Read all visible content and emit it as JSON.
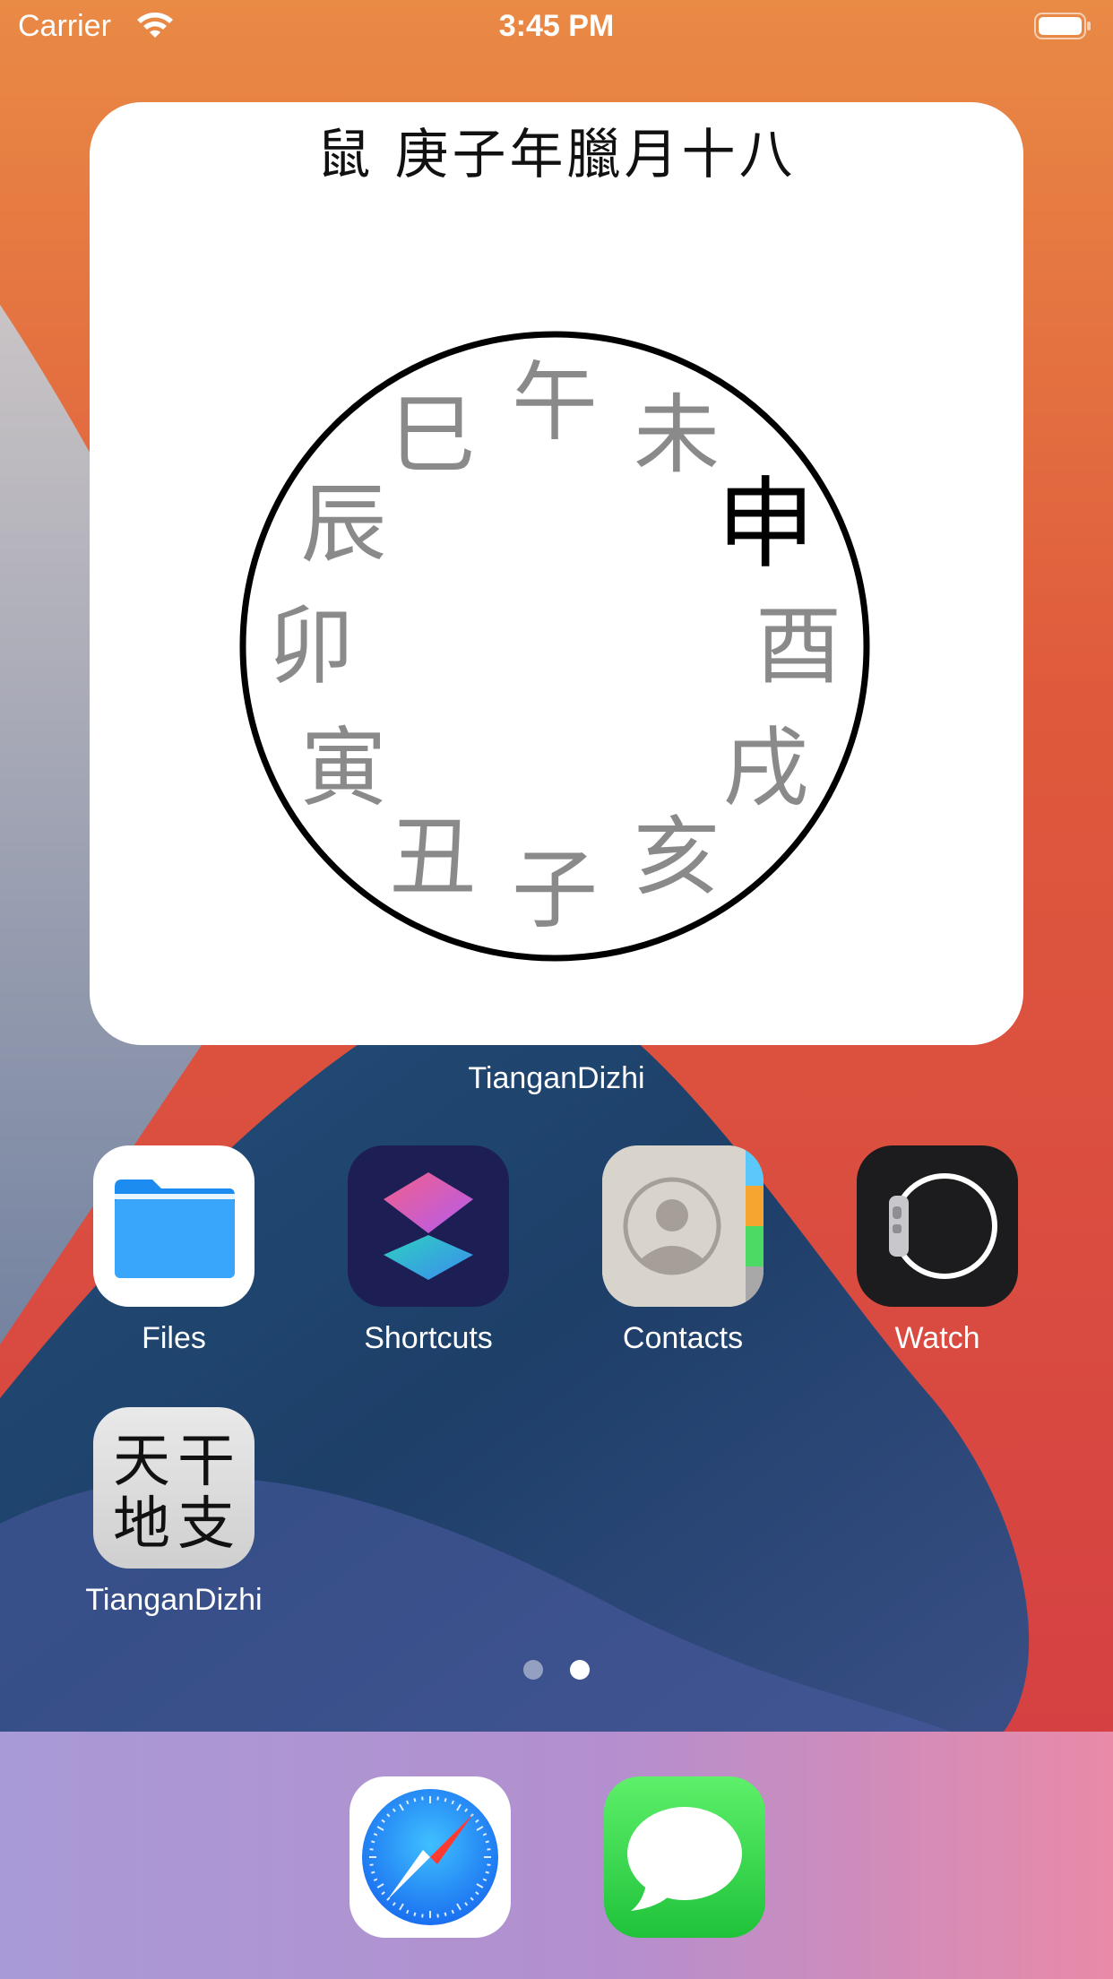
{
  "status_bar": {
    "carrier": "Carrier",
    "time": "3:45 PM"
  },
  "widget": {
    "title": "鼠 庚子年臘月十八",
    "branches": [
      "午",
      "未",
      "申",
      "酉",
      "戌",
      "亥",
      "子",
      "丑",
      "寅",
      "卯",
      "辰",
      "巳"
    ],
    "active_branch": "申",
    "label": "TianganDizhi"
  },
  "apps": [
    {
      "label": "Files",
      "icon": "files-icon"
    },
    {
      "label": "Shortcuts",
      "icon": "shortcuts-icon"
    },
    {
      "label": "Contacts",
      "icon": "contacts-icon"
    },
    {
      "label": "Watch",
      "icon": "watch-icon"
    },
    {
      "label": "TianganDizhi",
      "icon": "tiangandizhi-icon",
      "icon_text": [
        "天",
        "干",
        "地",
        "支"
      ]
    }
  ],
  "page_indicator": {
    "pages": 2,
    "current": 2
  },
  "dock": [
    {
      "name": "Safari",
      "icon": "safari-icon"
    },
    {
      "name": "Messages",
      "icon": "messages-icon"
    }
  ],
  "colors": {
    "branch_inactive": "#8a8a8a",
    "branch_active": "#000000"
  }
}
